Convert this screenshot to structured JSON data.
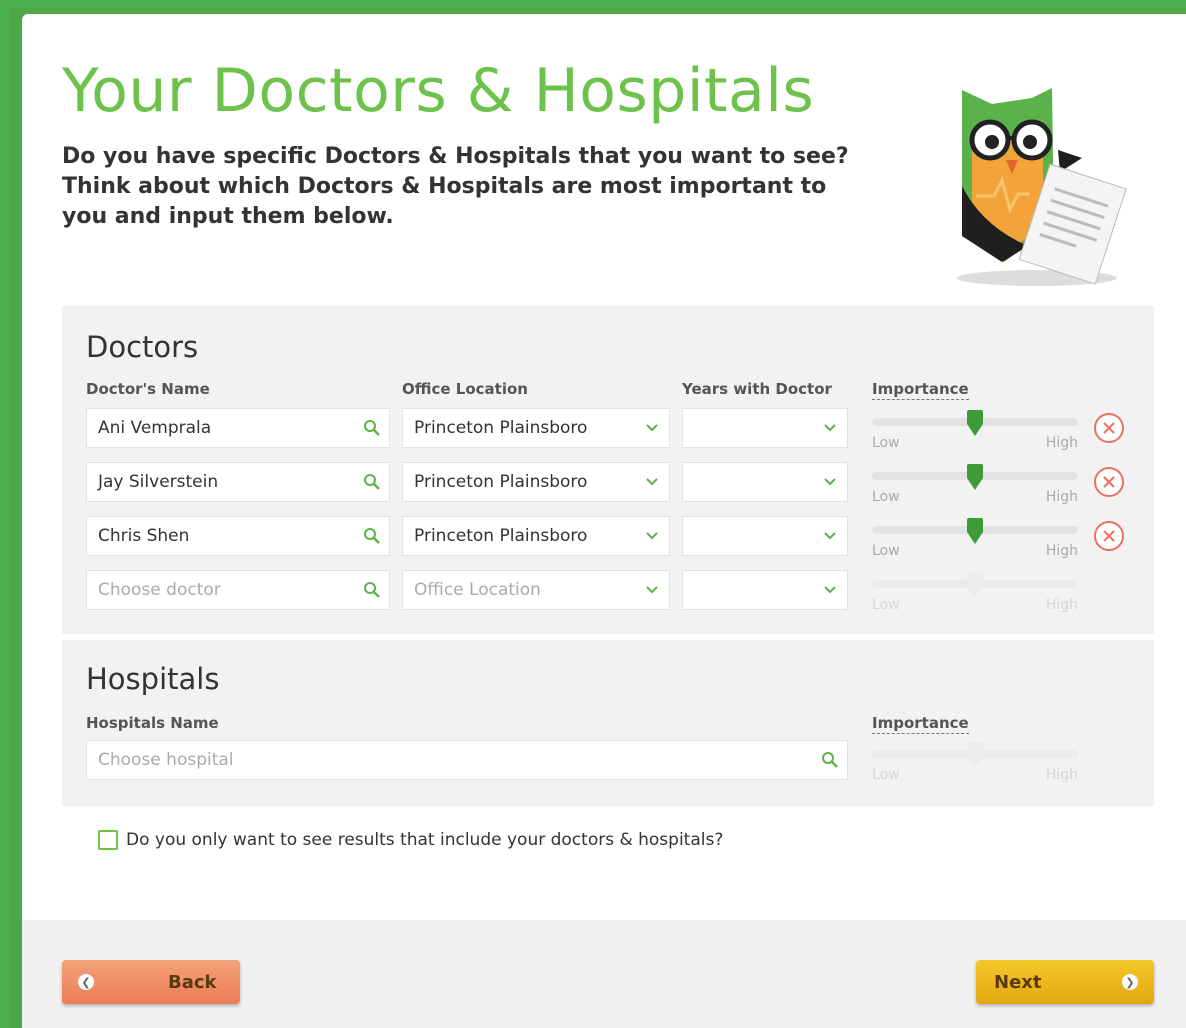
{
  "page": {
    "title": "Your Doctors & Hospitals",
    "intro": "Do you have specific Doctors & Hospitals that you want to see? Think about which Doctors & Hospitals are most important to you and input them below."
  },
  "doctors": {
    "section_title": "Doctors",
    "col_name": "Doctor's Name",
    "col_location": "Office Location",
    "col_years": "Years with Doctor",
    "col_importance": "Importance",
    "rows": [
      {
        "name": "Ani Vemprala",
        "location": "Princeton Plainsboro",
        "years": "",
        "importance": 0.5
      },
      {
        "name": "Jay Silverstein",
        "location": "Princeton Plainsboro",
        "years": "",
        "importance": 0.5
      },
      {
        "name": "Chris Shen",
        "location": "Princeton Plainsboro",
        "years": "",
        "importance": 0.5
      }
    ],
    "empty_row": {
      "name_placeholder": "Choose doctor",
      "location_placeholder": "Office Location"
    },
    "slider_low": "Low",
    "slider_high": "High"
  },
  "hospitals": {
    "section_title": "Hospitals",
    "col_name": "Hospitals Name",
    "col_importance": "Importance",
    "placeholder": "Choose hospital",
    "slider_low": "Low",
    "slider_high": "High"
  },
  "filter": {
    "checkbox_label": "Do you only want to see results that include your doctors & hospitals?",
    "checked": false
  },
  "footer": {
    "back_label": "Back",
    "next_label": "Next"
  },
  "colors": {
    "brand_green": "#6cc24a",
    "back_button": "#ec7c55",
    "next_button": "#e2a70f",
    "remove_red": "#e8725f"
  }
}
